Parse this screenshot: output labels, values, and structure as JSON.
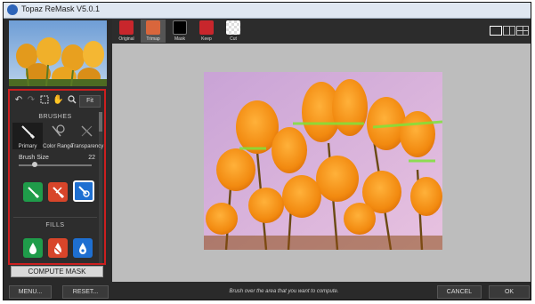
{
  "window": {
    "title": "Topaz ReMask V5.0.1"
  },
  "tools": {
    "fit_label": "Fit"
  },
  "brushes": {
    "section_title": "BRUSHES",
    "items": [
      {
        "label": "Primary"
      },
      {
        "label": "Color Range"
      },
      {
        "label": "Transparency"
      }
    ],
    "size_label": "Brush Size",
    "size_value": "22",
    "size_fraction": 0.22
  },
  "fills": {
    "section_title": "FILLS"
  },
  "compute_mask_label": "COMPUTE MASK",
  "tabs": [
    {
      "label": "Original",
      "color": "#c8262c"
    },
    {
      "label": "Trimap",
      "color": "#d9663c"
    },
    {
      "label": "Mask",
      "color": "#ffffff"
    },
    {
      "label": "Keep",
      "color": "#c8262c"
    },
    {
      "label": "Cut",
      "color": "#e8e8e8"
    }
  ],
  "bottom": {
    "menu_label": "MENU...",
    "reset_label": "RESET...",
    "status": "Brush over the area that you want to compute.",
    "cancel_label": "CANCEL",
    "ok_label": "OK"
  },
  "colors": {
    "keep": "#1f9c4a",
    "cut": "#d8452a",
    "compute": "#1e6fd1",
    "highlight": "#cc1f1f"
  }
}
